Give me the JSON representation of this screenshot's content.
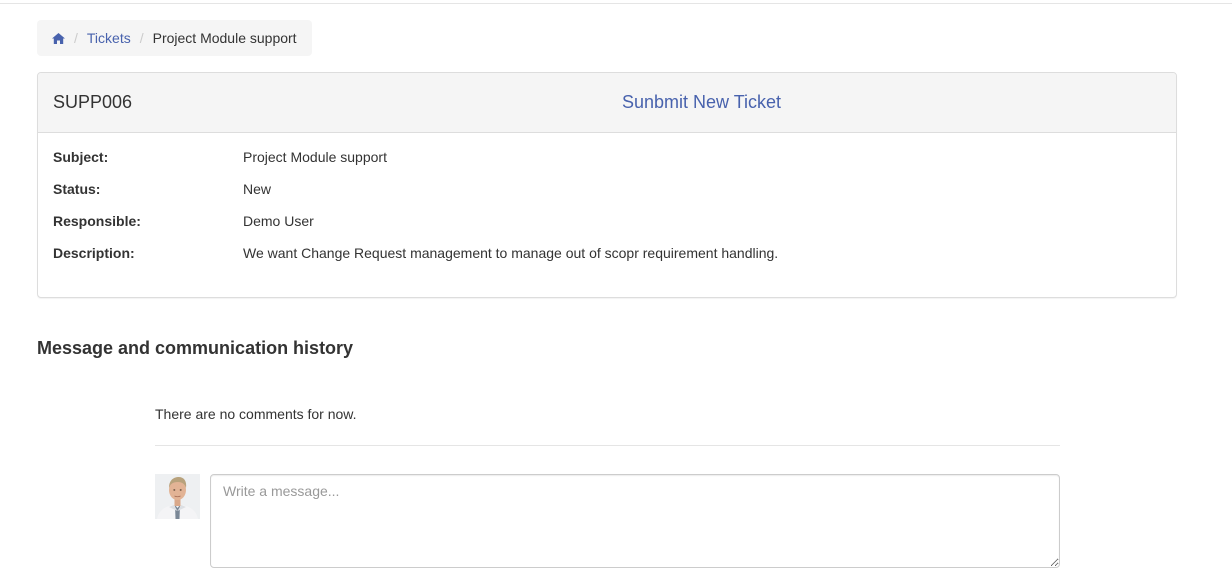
{
  "breadcrumb": {
    "home_icon": "home-icon",
    "tickets_label": "Tickets",
    "current_label": "Project Module support"
  },
  "ticket": {
    "id": "SUPP006",
    "submit_label": "Sunbmit New Ticket",
    "fields": [
      {
        "label": "Subject:",
        "value": "Project Module support"
      },
      {
        "label": "Status:",
        "value": "New"
      },
      {
        "label": "Responsible:",
        "value": "Demo User"
      },
      {
        "label": "Description:",
        "value": "We want Change Request management to manage out of scopr requirement handling."
      }
    ]
  },
  "history": {
    "title": "Message and communication history",
    "empty_text": "There are no comments for now.",
    "message_placeholder": "Write a message..."
  },
  "colors": {
    "link": "#4862ad",
    "panel_heading_bg": "#f5f5f5",
    "border": "#dddddd"
  }
}
